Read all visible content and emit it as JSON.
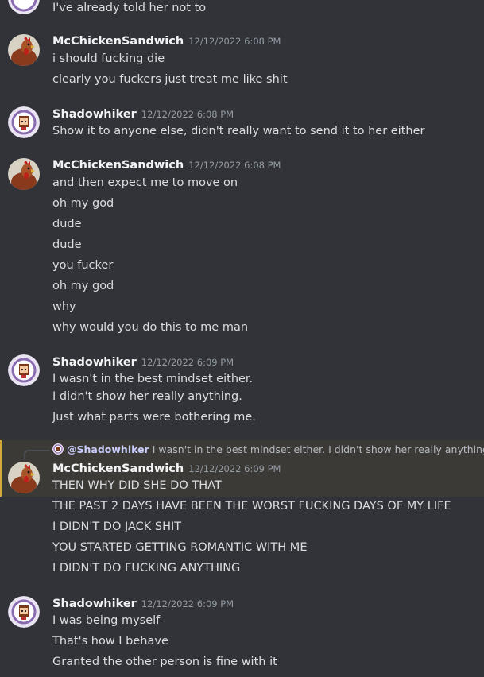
{
  "top_fragment": "I've already told her not to",
  "reply": {
    "mention": "@Shadowhiker",
    "text": "I wasn't in the best mindset either. I didn't show her really anything."
  },
  "messages": [
    {
      "author": "McChickenSandwich",
      "timestamp": "12/12/2022 6:08 PM",
      "lines": [
        "i should fucking die",
        "clearly you fuckers just treat me like shit"
      ]
    },
    {
      "author": "Shadowhiker",
      "timestamp": "12/12/2022 6:08 PM",
      "lines": [
        "Show it to anyone else, didn't really want to send it to her either"
      ]
    },
    {
      "author": "McChickenSandwich",
      "timestamp": "12/12/2022 6:08 PM",
      "lines": [
        "and then expect me to move on",
        "oh my god",
        "dude",
        "dude",
        "you fucker",
        "oh my god",
        "why",
        "why would you do this to me man"
      ]
    },
    {
      "author": "Shadowhiker",
      "timestamp": "12/12/2022 6:09 PM",
      "lines": [
        "I wasn't in the best mindset either.",
        "I didn't show her really anything.",
        "Just what parts were bothering me."
      ]
    },
    {
      "author": "McChickenSandwich",
      "timestamp": "12/12/2022 6:09 PM",
      "lines": [
        "THEN WHY DID SHE DO THAT",
        "THE PAST 2 DAYS HAVE BEEN THE WORST FUCKING DAYS OF MY LIFE",
        "I DIDN'T DO JACK SHIT",
        "YOU STARTED GETTING ROMANTIC WITH ME",
        "I DIDN'T DO FUCKING ANYTHING"
      ]
    },
    {
      "author": "Shadowhiker",
      "timestamp": "12/12/2022 6:09 PM",
      "lines": [
        "I was being myself",
        "That's how I behave",
        "Granted the other person is fine with it"
      ]
    }
  ]
}
